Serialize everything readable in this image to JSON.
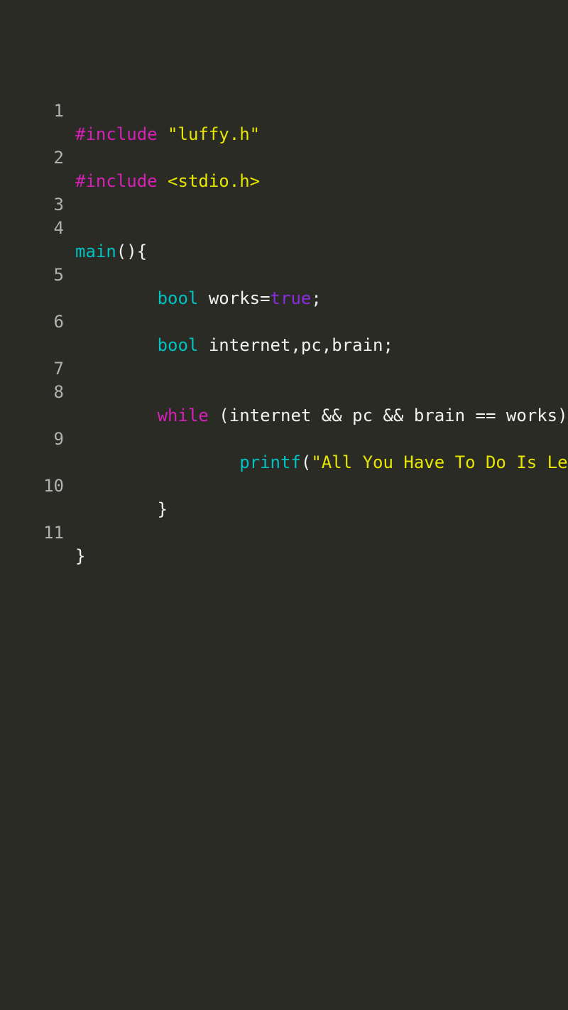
{
  "colors": {
    "background": "#2a2b25",
    "gutter": "#b0b0b0",
    "magenta": "#d81fb8",
    "yellow": "#e6e600",
    "cyan": "#00c2c2",
    "white": "#f2f2f2",
    "purple": "#8a2be2"
  },
  "line_numbers": {
    "l1": "1",
    "l2": "2",
    "l3": "3",
    "l4": "4",
    "l5": "5",
    "l6": "6",
    "l7": "7",
    "l8": "8",
    "l9": "9",
    "l10": "10",
    "l11": "11"
  },
  "tokens": {
    "include1": "#include",
    "str_luffy_q1": " \"",
    "str_luffy": "luffy.h",
    "str_luffy_q2": "\"",
    "include2": "#include",
    "stdio": " <stdio.h>",
    "main": "main",
    "main_paren": "(){",
    "indent8": "        ",
    "indent16": "                ",
    "bool1": "bool",
    "works_eq": " works=",
    "true": "true",
    "semi1": ";",
    "bool2": "bool",
    "vars": " internet,pc,brain;",
    "while": "while",
    "while_cond": " (internet && pc && brain == works){",
    "printf": "printf",
    "printf_open": "(",
    "printf_str": "\"All You Have To Do Is Learn....!\"",
    "printf_close": ");",
    "close_brace": "}",
    "close_brace2": "}"
  }
}
